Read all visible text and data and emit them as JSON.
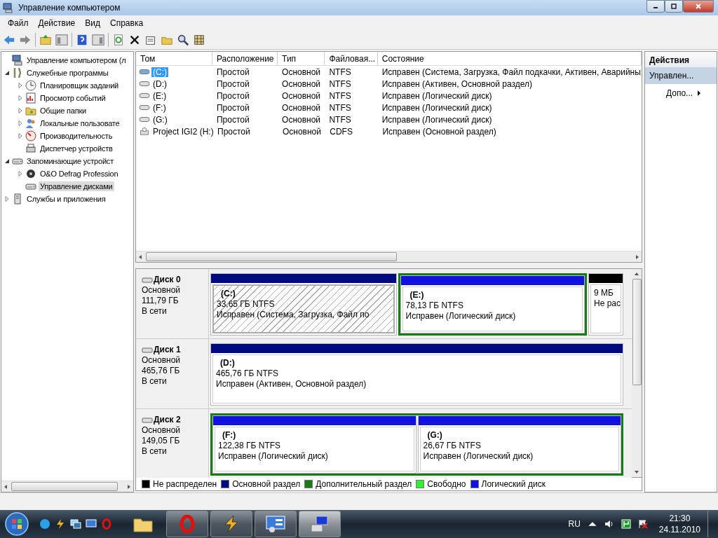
{
  "window": {
    "title": "Управление компьютером"
  },
  "menu": [
    "Файл",
    "Действие",
    "Вид",
    "Справка"
  ],
  "tree": [
    {
      "label": "Управление компьютером (л",
      "kind": "computer",
      "selected": false
    },
    {
      "label": "Служебные программы",
      "kind": "tools",
      "expanded": true,
      "selected": false,
      "children": [
        {
          "label": "Планировщик заданий",
          "kind": "clock",
          "expanded": false,
          "selected": false
        },
        {
          "label": "Просмотр событий",
          "kind": "log",
          "expanded": false,
          "selected": false
        },
        {
          "label": "Общие папки",
          "kind": "share",
          "expanded": false,
          "selected": false
        },
        {
          "label": "Локальные пользовате",
          "kind": "users",
          "expanded": false,
          "selected": false
        },
        {
          "label": "Производительность",
          "kind": "perf",
          "expanded": false,
          "selected": false
        },
        {
          "label": "Диспетчер устройств",
          "kind": "devices",
          "selected": false
        }
      ]
    },
    {
      "label": "Запоминающие устройст",
      "kind": "storage",
      "expanded": true,
      "selected": false,
      "children": [
        {
          "label": "O&O Defrag Profession",
          "kind": "defrag",
          "expanded": false,
          "selected": false
        },
        {
          "label": "Управление дисками",
          "kind": "disks",
          "selected": true
        }
      ]
    },
    {
      "label": "Службы и приложения",
      "kind": "services",
      "expanded": false,
      "selected": false
    }
  ],
  "volumes": {
    "columns": [
      "Том",
      "Расположение",
      "Тип",
      "Файловая...",
      "Состояние"
    ],
    "rows": [
      {
        "kind": "disk",
        "selected": true,
        "cells": [
          "(C:)",
          "Простой",
          "Основной",
          "NTFS",
          "Исправен (Система, Загрузка, Файл подкачки, Активен, Аварийны"
        ]
      },
      {
        "kind": "disk",
        "selected": false,
        "cells": [
          "(D:)",
          "Простой",
          "Основной",
          "NTFS",
          "Исправен (Активен, Основной раздел)"
        ]
      },
      {
        "kind": "disk",
        "selected": false,
        "cells": [
          "(E:)",
          "Простой",
          "Основной",
          "NTFS",
          "Исправен (Логический диск)"
        ]
      },
      {
        "kind": "disk",
        "selected": false,
        "cells": [
          "(F:)",
          "Простой",
          "Основной",
          "NTFS",
          "Исправен (Логический диск)"
        ]
      },
      {
        "kind": "disk",
        "selected": false,
        "cells": [
          "(G:)",
          "Простой",
          "Основной",
          "NTFS",
          "Исправен (Логический диск)"
        ]
      },
      {
        "kind": "cd",
        "selected": false,
        "cells": [
          "Project IGI2 (H:)",
          "Простой",
          "Основной",
          "CDFS",
          "Исправен (Основной раздел)"
        ]
      }
    ]
  },
  "disks": [
    {
      "name": "Диск 0",
      "type": "Основной",
      "size": "111,79 ГБ",
      "status": "В сети",
      "segments": [
        {
          "kind": "primary",
          "label": "(C:)",
          "size": "33,65 ГБ NTFS",
          "status": "Исправен (Система, Загрузка, Файл по",
          "selected": true
        },
        {
          "kind": "extended",
          "children": [
            {
              "kind": "logical",
              "label": "(E:)",
              "size": "78,13 ГБ NTFS",
              "status": "Исправен (Логический диск)",
              "selected": false
            }
          ]
        },
        {
          "kind": "unallocated",
          "size": "9 МБ",
          "status": "Не рас",
          "selected": false
        }
      ]
    },
    {
      "name": "Диск 1",
      "type": "Основной",
      "size": "465,76 ГБ",
      "status": "В сети",
      "segments": [
        {
          "kind": "primary",
          "label": "(D:)",
          "size": "465,76 ГБ NTFS",
          "status": "Исправен (Активен, Основной раздел)",
          "selected": false
        }
      ]
    },
    {
      "name": "Диск 2",
      "type": "Основной",
      "size": "149,05 ГБ",
      "status": "В сети",
      "segments": [
        {
          "kind": "extended",
          "children": [
            {
              "kind": "logical",
              "label": "(F:)",
              "size": "122,38 ГБ NTFS",
              "status": "Исправен (Логический диск)",
              "selected": false
            },
            {
              "kind": "logical",
              "label": "(G:)",
              "size": "26,67 ГБ NTFS",
              "status": "Исправен (Логический диск)",
              "selected": false
            }
          ]
        }
      ]
    }
  ],
  "legend": [
    {
      "label": "Не распределен",
      "color": "#000000"
    },
    {
      "label": "Основной раздел",
      "color": "#000a80"
    },
    {
      "label": "Дополнительный раздел",
      "color": "#1a7a1a"
    },
    {
      "label": "Свободно",
      "color": "#33ee33"
    },
    {
      "label": "Логический диск",
      "color": "#1010e0"
    }
  ],
  "actions": {
    "title": "Действия",
    "items": [
      {
        "kind": "header",
        "label": "Управлен..."
      },
      {
        "kind": "link",
        "label": "Допо..."
      }
    ]
  },
  "taskbar": {
    "language": "RU",
    "time": "21:30",
    "date": "24.11.2010"
  }
}
